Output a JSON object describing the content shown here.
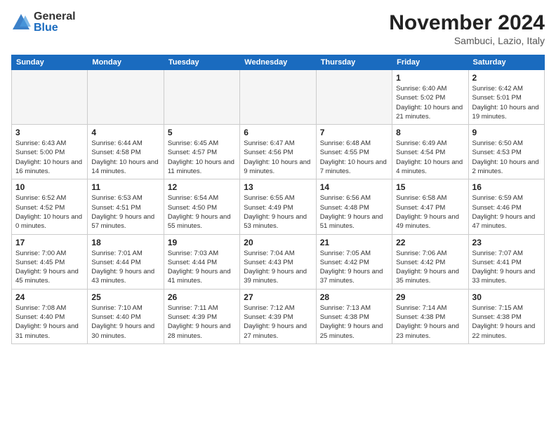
{
  "logo": {
    "general": "General",
    "blue": "Blue"
  },
  "title": "November 2024",
  "location": "Sambuci, Lazio, Italy",
  "weekdays": [
    "Sunday",
    "Monday",
    "Tuesday",
    "Wednesday",
    "Thursday",
    "Friday",
    "Saturday"
  ],
  "weeks": [
    [
      {
        "day": "",
        "info": ""
      },
      {
        "day": "",
        "info": ""
      },
      {
        "day": "",
        "info": ""
      },
      {
        "day": "",
        "info": ""
      },
      {
        "day": "",
        "info": ""
      },
      {
        "day": "1",
        "info": "Sunrise: 6:40 AM\nSunset: 5:02 PM\nDaylight: 10 hours and 21 minutes."
      },
      {
        "day": "2",
        "info": "Sunrise: 6:42 AM\nSunset: 5:01 PM\nDaylight: 10 hours and 19 minutes."
      }
    ],
    [
      {
        "day": "3",
        "info": "Sunrise: 6:43 AM\nSunset: 5:00 PM\nDaylight: 10 hours and 16 minutes."
      },
      {
        "day": "4",
        "info": "Sunrise: 6:44 AM\nSunset: 4:58 PM\nDaylight: 10 hours and 14 minutes."
      },
      {
        "day": "5",
        "info": "Sunrise: 6:45 AM\nSunset: 4:57 PM\nDaylight: 10 hours and 11 minutes."
      },
      {
        "day": "6",
        "info": "Sunrise: 6:47 AM\nSunset: 4:56 PM\nDaylight: 10 hours and 9 minutes."
      },
      {
        "day": "7",
        "info": "Sunrise: 6:48 AM\nSunset: 4:55 PM\nDaylight: 10 hours and 7 minutes."
      },
      {
        "day": "8",
        "info": "Sunrise: 6:49 AM\nSunset: 4:54 PM\nDaylight: 10 hours and 4 minutes."
      },
      {
        "day": "9",
        "info": "Sunrise: 6:50 AM\nSunset: 4:53 PM\nDaylight: 10 hours and 2 minutes."
      }
    ],
    [
      {
        "day": "10",
        "info": "Sunrise: 6:52 AM\nSunset: 4:52 PM\nDaylight: 10 hours and 0 minutes."
      },
      {
        "day": "11",
        "info": "Sunrise: 6:53 AM\nSunset: 4:51 PM\nDaylight: 9 hours and 57 minutes."
      },
      {
        "day": "12",
        "info": "Sunrise: 6:54 AM\nSunset: 4:50 PM\nDaylight: 9 hours and 55 minutes."
      },
      {
        "day": "13",
        "info": "Sunrise: 6:55 AM\nSunset: 4:49 PM\nDaylight: 9 hours and 53 minutes."
      },
      {
        "day": "14",
        "info": "Sunrise: 6:56 AM\nSunset: 4:48 PM\nDaylight: 9 hours and 51 minutes."
      },
      {
        "day": "15",
        "info": "Sunrise: 6:58 AM\nSunset: 4:47 PM\nDaylight: 9 hours and 49 minutes."
      },
      {
        "day": "16",
        "info": "Sunrise: 6:59 AM\nSunset: 4:46 PM\nDaylight: 9 hours and 47 minutes."
      }
    ],
    [
      {
        "day": "17",
        "info": "Sunrise: 7:00 AM\nSunset: 4:45 PM\nDaylight: 9 hours and 45 minutes."
      },
      {
        "day": "18",
        "info": "Sunrise: 7:01 AM\nSunset: 4:44 PM\nDaylight: 9 hours and 43 minutes."
      },
      {
        "day": "19",
        "info": "Sunrise: 7:03 AM\nSunset: 4:44 PM\nDaylight: 9 hours and 41 minutes."
      },
      {
        "day": "20",
        "info": "Sunrise: 7:04 AM\nSunset: 4:43 PM\nDaylight: 9 hours and 39 minutes."
      },
      {
        "day": "21",
        "info": "Sunrise: 7:05 AM\nSunset: 4:42 PM\nDaylight: 9 hours and 37 minutes."
      },
      {
        "day": "22",
        "info": "Sunrise: 7:06 AM\nSunset: 4:42 PM\nDaylight: 9 hours and 35 minutes."
      },
      {
        "day": "23",
        "info": "Sunrise: 7:07 AM\nSunset: 4:41 PM\nDaylight: 9 hours and 33 minutes."
      }
    ],
    [
      {
        "day": "24",
        "info": "Sunrise: 7:08 AM\nSunset: 4:40 PM\nDaylight: 9 hours and 31 minutes."
      },
      {
        "day": "25",
        "info": "Sunrise: 7:10 AM\nSunset: 4:40 PM\nDaylight: 9 hours and 30 minutes."
      },
      {
        "day": "26",
        "info": "Sunrise: 7:11 AM\nSunset: 4:39 PM\nDaylight: 9 hours and 28 minutes."
      },
      {
        "day": "27",
        "info": "Sunrise: 7:12 AM\nSunset: 4:39 PM\nDaylight: 9 hours and 27 minutes."
      },
      {
        "day": "28",
        "info": "Sunrise: 7:13 AM\nSunset: 4:38 PM\nDaylight: 9 hours and 25 minutes."
      },
      {
        "day": "29",
        "info": "Sunrise: 7:14 AM\nSunset: 4:38 PM\nDaylight: 9 hours and 23 minutes."
      },
      {
        "day": "30",
        "info": "Sunrise: 7:15 AM\nSunset: 4:38 PM\nDaylight: 9 hours and 22 minutes."
      }
    ]
  ]
}
